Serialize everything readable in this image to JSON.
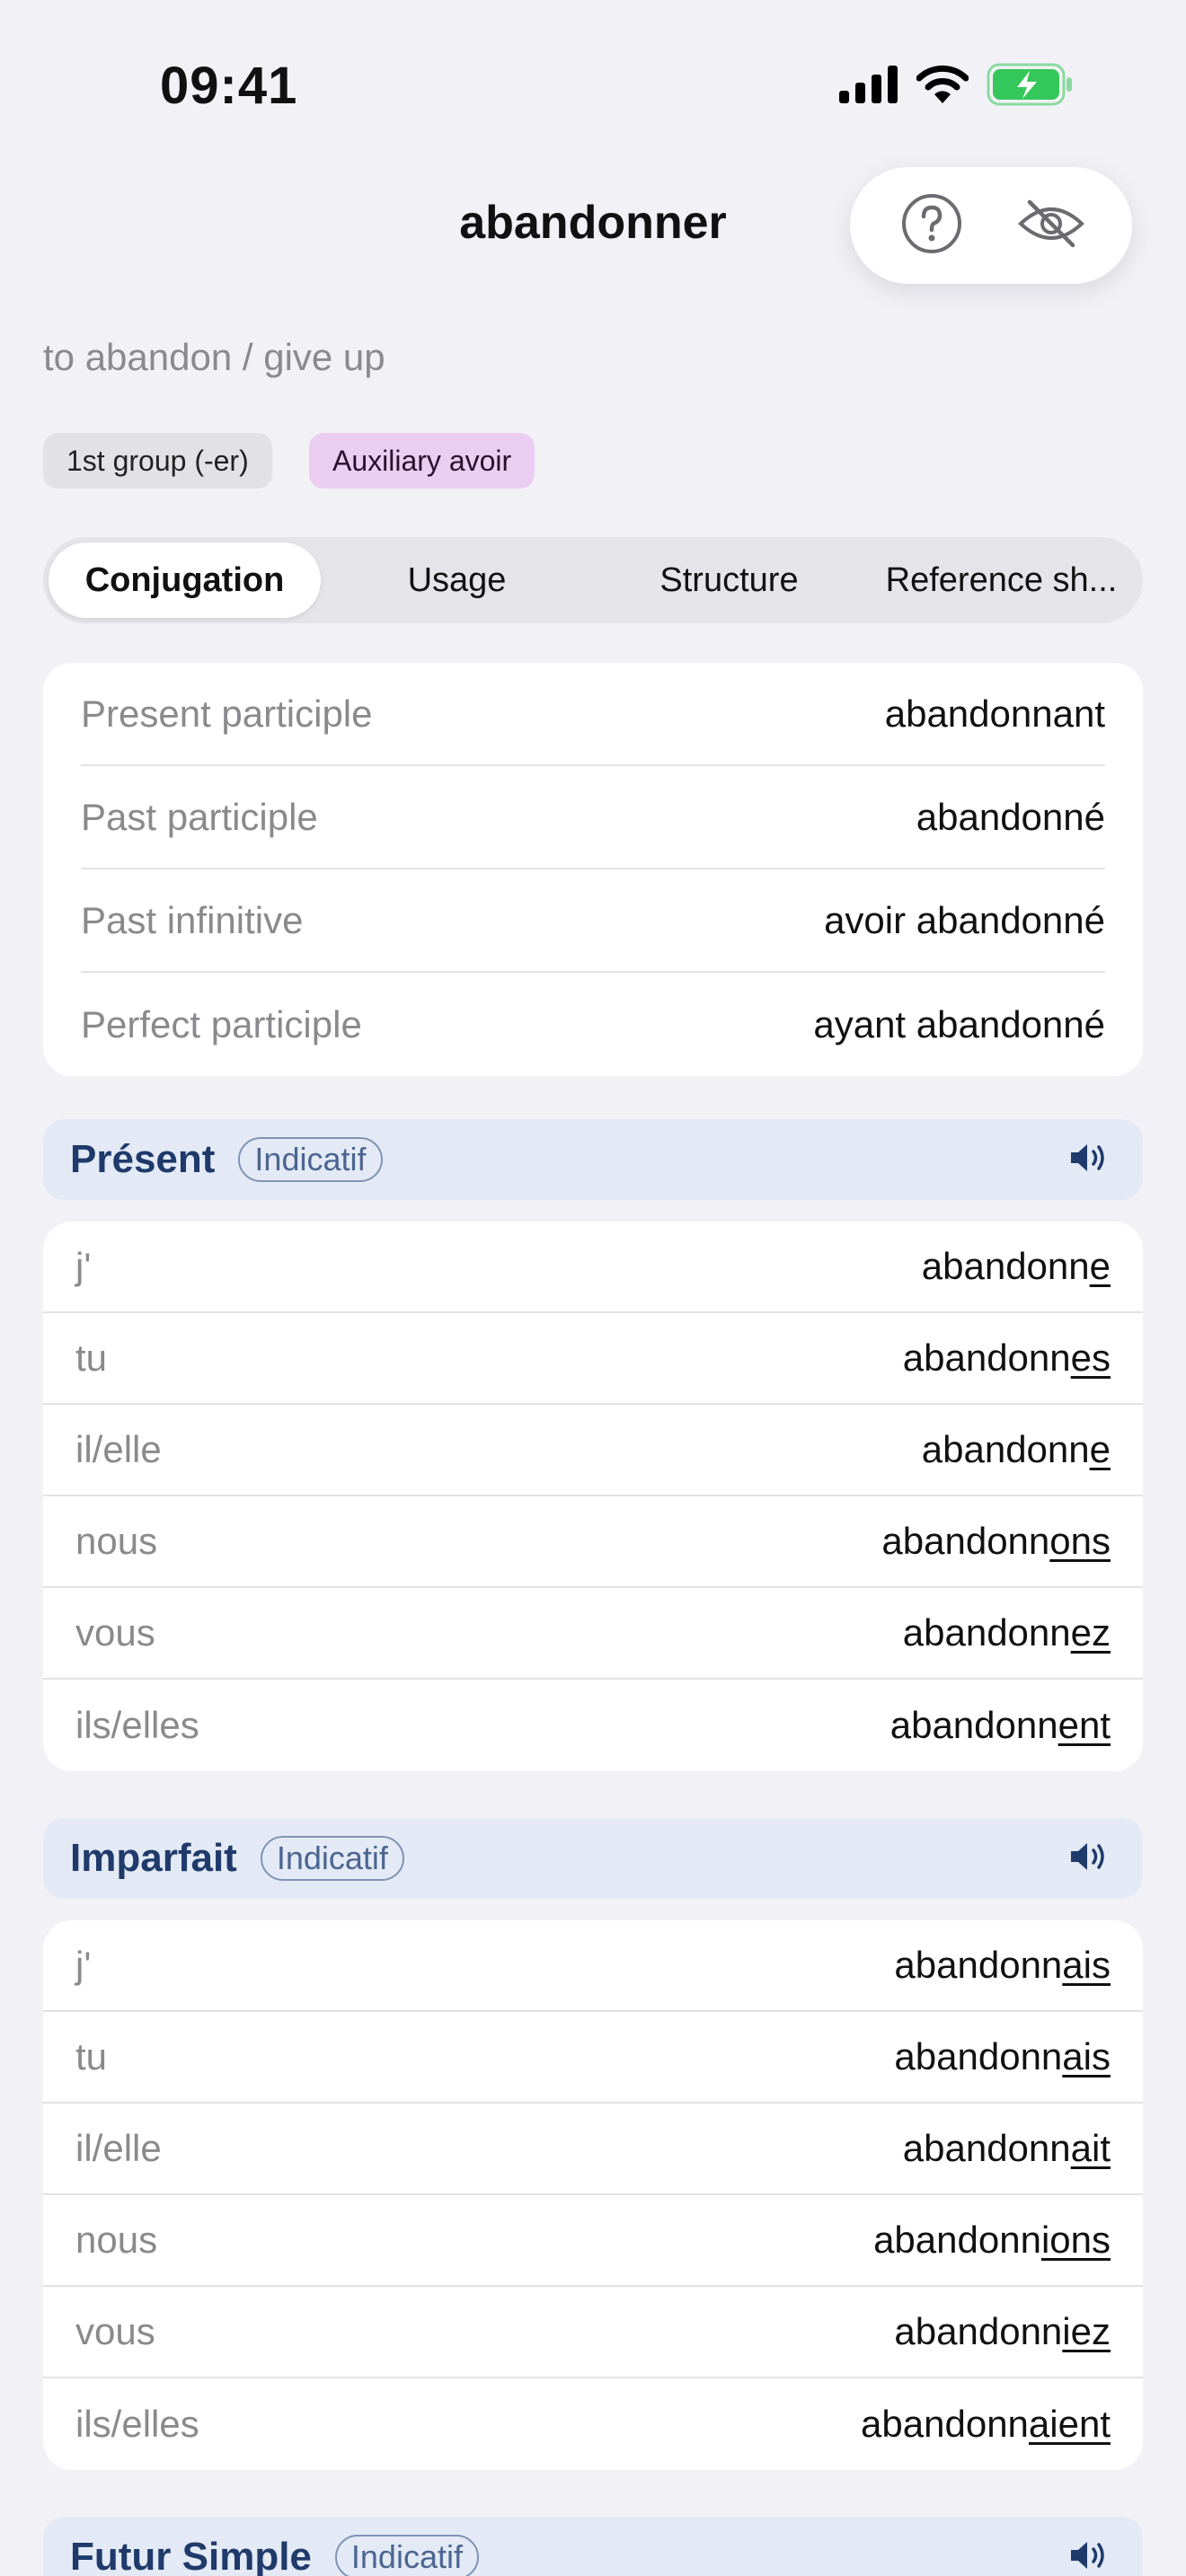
{
  "status_bar": {
    "time": "09:41"
  },
  "header": {
    "title": "abandonner",
    "translation": "to abandon / give up",
    "chips": {
      "group": "1st group (-er)",
      "auxiliary": "Auxiliary avoir"
    }
  },
  "tabs": [
    "Conjugation",
    "Usage",
    "Structure",
    "Reference sh..."
  ],
  "forms": [
    {
      "label": "Present participle",
      "value": "abandonnant"
    },
    {
      "label": "Past participle",
      "value": "abandonné"
    },
    {
      "label": "Past infinitive",
      "value": "avoir abandonné"
    },
    {
      "label": "Perfect participle",
      "value": "ayant abandonné"
    }
  ],
  "tenses": [
    {
      "name": "Présent",
      "mood": "Indicatif",
      "rows": [
        {
          "pronoun": "j'",
          "stem": "abandonn",
          "ending": "e"
        },
        {
          "pronoun": "tu",
          "stem": "abandonn",
          "ending": "es"
        },
        {
          "pronoun": "il/elle",
          "stem": "abandonn",
          "ending": "e"
        },
        {
          "pronoun": "nous",
          "stem": "abandonn",
          "ending": "ons"
        },
        {
          "pronoun": "vous",
          "stem": "abandonn",
          "ending": "ez"
        },
        {
          "pronoun": "ils/elles",
          "stem": "abandonn",
          "ending": "ent"
        }
      ]
    },
    {
      "name": "Imparfait",
      "mood": "Indicatif",
      "rows": [
        {
          "pronoun": "j'",
          "stem": "abandonn",
          "ending": "ais"
        },
        {
          "pronoun": "tu",
          "stem": "abandonn",
          "ending": "ais"
        },
        {
          "pronoun": "il/elle",
          "stem": "abandonn",
          "ending": "ait"
        },
        {
          "pronoun": "nous",
          "stem": "abandonn",
          "ending": "ions"
        },
        {
          "pronoun": "vous",
          "stem": "abandonn",
          "ending": "iez"
        },
        {
          "pronoun": "ils/elles",
          "stem": "abandonn",
          "ending": "aient"
        }
      ]
    },
    {
      "name": "Futur Simple",
      "mood": "Indicatif"
    }
  ],
  "colors": {
    "background": "#f2f1f6",
    "tense_header": "#e3eaf5",
    "tense_title": "#1f3a6b",
    "auxiliary_chip": "#eccdf2",
    "battery": "#34c759"
  }
}
